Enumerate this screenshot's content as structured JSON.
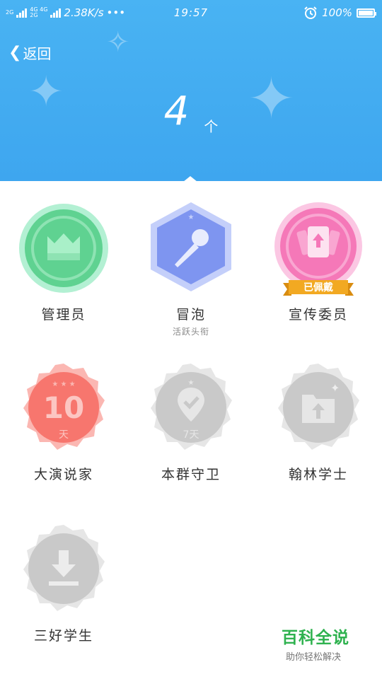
{
  "status_bar": {
    "net_left": "2G",
    "net_mid_top": "4G 4G",
    "net_mid_bot": "2G",
    "speed": "2.38K/s",
    "dots": "•••",
    "time": "19:57",
    "battery": "100%"
  },
  "header": {
    "back_label": "返回",
    "count_value": "4",
    "count_unit": "个"
  },
  "badges": [
    {
      "name": "管理员",
      "subtitle": ""
    },
    {
      "name": "冒泡",
      "subtitle": "活跃头衔"
    },
    {
      "name": "宣传委员",
      "subtitle": "",
      "ribbon": "已佩戴"
    },
    {
      "name": "大演说家",
      "subtitle": "",
      "number": "10",
      "unit": "天"
    },
    {
      "name": "本群守卫",
      "subtitle": "",
      "unit": "7天"
    },
    {
      "name": "翰林学士",
      "subtitle": ""
    },
    {
      "name": "三好学生",
      "subtitle": ""
    }
  ],
  "watermark": {
    "title": "百科全说",
    "subtitle": "助你轻松解决"
  },
  "colors": {
    "header_blue": "#3ea6ef",
    "admin_green": "#5fd291",
    "bubble_blue": "#7e95f0",
    "promo_pink": "#f578b8",
    "orator_red": "#f7766e",
    "inactive_gray": "#c9c9c9",
    "ribbon_gold": "#f2a922"
  }
}
